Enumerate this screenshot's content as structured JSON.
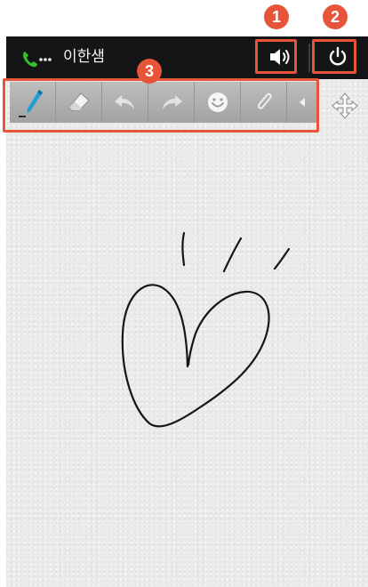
{
  "call": {
    "caller_name": "이한샘",
    "icon": "phone-call-icon"
  },
  "controls": {
    "speaker_icon": "speaker-icon",
    "power_icon": "power-icon"
  },
  "toolbar": {
    "tools": [
      "pen-icon",
      "eraser-icon",
      "undo-icon",
      "redo-icon",
      "emoticon-icon",
      "attachment-icon",
      "collapse-arrow-icon"
    ],
    "move_icon": "move-icon"
  },
  "annotations": {
    "speaker": "1",
    "power": "2",
    "toolbar": "3"
  },
  "colors": {
    "accent": "#e8543a",
    "pen": "#1f9fd6",
    "call_green": "#35c02b",
    "statusbar": "#141516"
  }
}
